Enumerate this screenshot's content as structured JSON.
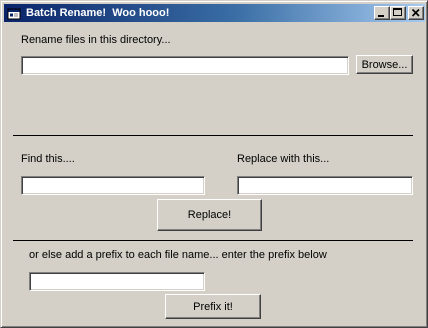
{
  "window": {
    "title": "Batch Rename!  Woo hooo!",
    "icon": "app-window-icon",
    "controls": {
      "minimize_icon": "minimize-icon",
      "maximize_icon": "maximize-icon",
      "close_icon": "close-icon"
    },
    "colors": {
      "face": "#d4d0c8",
      "title_start": "#0a246a",
      "title_end": "#a6caf0"
    }
  },
  "directory_section": {
    "label": "Rename files in this directory...",
    "directory_value": "",
    "browse_label": "Browse..."
  },
  "find_replace_section": {
    "find_label": "Find this....",
    "find_value": "",
    "replace_label": "Replace with this...",
    "replace_value": "",
    "replace_button_label": "Replace!"
  },
  "prefix_section": {
    "label": "or else add a prefix to each file name... enter the prefix below",
    "prefix_value": "",
    "prefix_button_label": "Prefix it!"
  }
}
